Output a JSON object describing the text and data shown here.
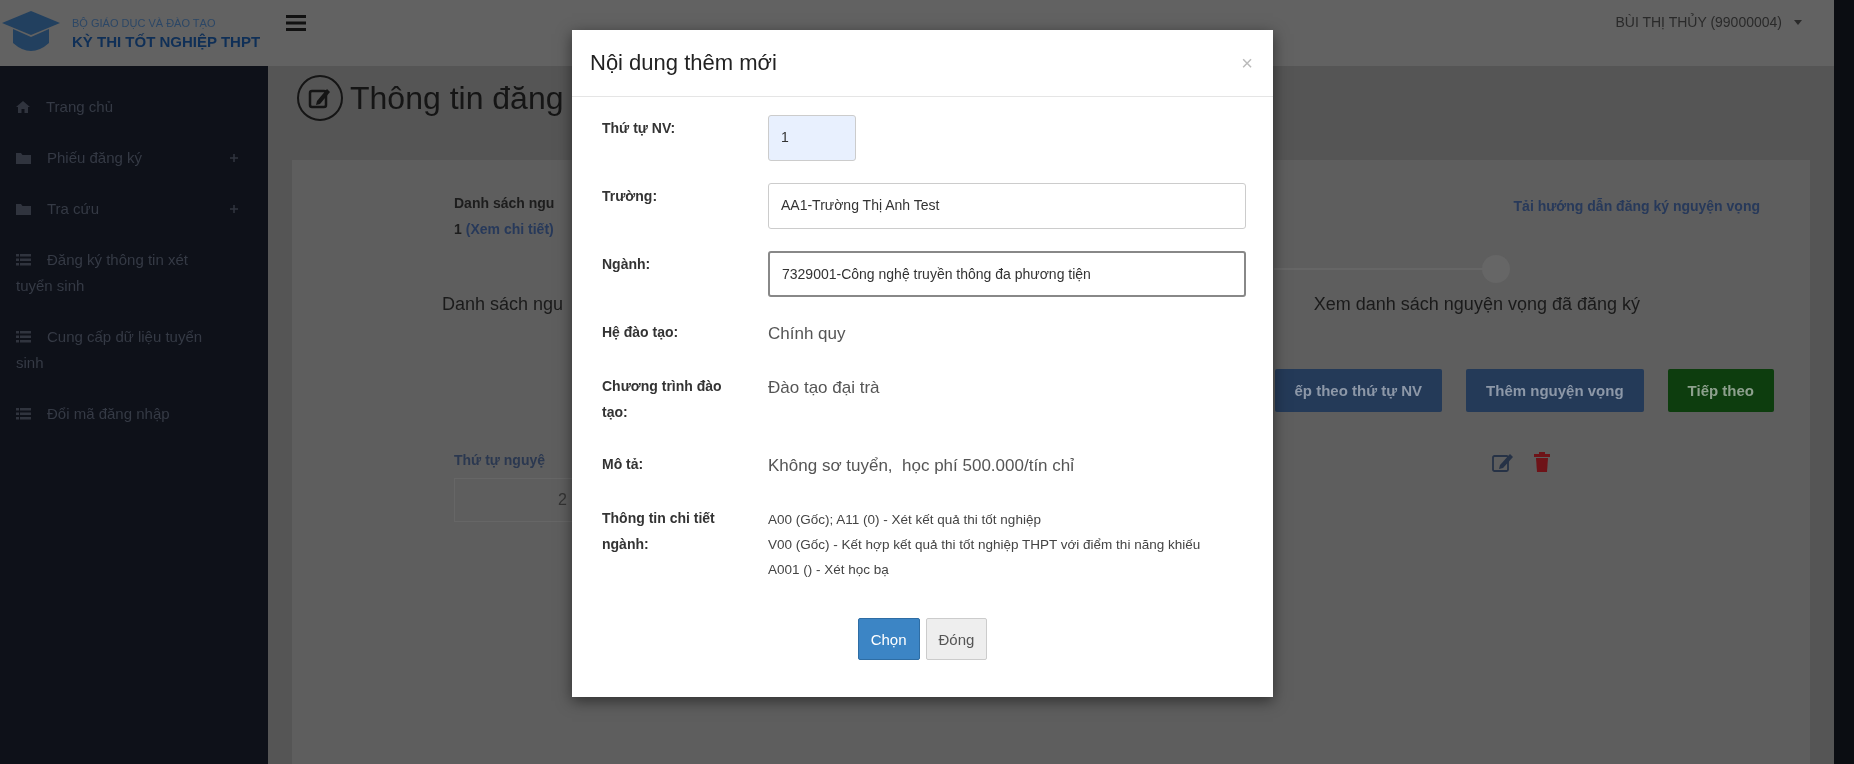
{
  "header": {
    "org": "BỘ GIÁO DỤC VÀ ĐÀO TẠO",
    "title": "KỲ THI TỐT NGHIỆP THPT",
    "user": "BÙI THỊ THỦY (99000004)"
  },
  "sidebar": {
    "items": [
      {
        "label": "Trang chủ",
        "kind": "home",
        "expandable": false
      },
      {
        "label": "Phiếu đăng ký",
        "kind": "folder",
        "expandable": true
      },
      {
        "label": "Tra cứu",
        "kind": "folder",
        "expandable": true
      },
      {
        "label": "Đăng ký thông tin xét tuyển sinh",
        "kind": "list",
        "expandable": false
      },
      {
        "label": "Cung cấp dữ liệu tuyển sinh",
        "kind": "list",
        "expandable": false
      },
      {
        "label": "Đổi mã đăng nhập",
        "kind": "list",
        "expandable": false
      }
    ]
  },
  "page": {
    "title": "Thông tin đăng",
    "summary_label": "Danh sách ngu",
    "summary_count": "1",
    "summary_link": "(Xem chi tiết)",
    "guide_link": "Tải hướng dẫn đăng ký nguyện vọng",
    "steps": [
      {
        "label": "Danh sách ngu"
      },
      {
        "label": "Xem danh sách nguyện vọng đã đăng ký"
      }
    ],
    "buttons": [
      {
        "label": "ếp theo thứ tự NV",
        "kind": "primary"
      },
      {
        "label": "Thêm nguyện vọng",
        "kind": "primary"
      },
      {
        "label": "Tiếp theo",
        "kind": "success"
      }
    ],
    "table": {
      "column_1": "Thứ tự nguyệ",
      "rows": [
        {
          "order": "2"
        }
      ]
    }
  },
  "modal": {
    "title": "Nội dung thêm mới",
    "close": "×",
    "fields": [
      {
        "label": "Thứ tự NV:",
        "kind": "number",
        "value": "1",
        "focused": false
      },
      {
        "label": "Trường:",
        "kind": "input",
        "value": "AA1-Trường Thị Anh Test",
        "focused": false
      },
      {
        "label": "Ngành:",
        "kind": "input",
        "value": "7329001-Công nghệ truyền thông đa phương tiện",
        "focused": true
      },
      {
        "label": "Hệ đào tạo:",
        "kind": "text",
        "value": "Chính quy"
      },
      {
        "label": "Chương trình đào tạo:",
        "kind": "text",
        "value": "Đào tạo đại trà"
      },
      {
        "label": "Mô tả:",
        "kind": "text",
        "value": "Không sơ tuyển,  học phí 500.000/tín chỉ"
      },
      {
        "label": "Thông tin chi tiết ngành:",
        "kind": "lines",
        "lines": [
          "A00 (Gốc); A11 (0) - Xét kết quả thi tốt nghiệp",
          "V00 (Gốc) - Kết hợp kết quả thi tốt nghiệp THPT với điểm thi năng khiếu",
          "A001 () - Xét học bạ"
        ]
      }
    ],
    "buttons": [
      {
        "label": "Chọn",
        "kind": "primary"
      },
      {
        "label": "Đóng",
        "kind": "default"
      }
    ]
  }
}
